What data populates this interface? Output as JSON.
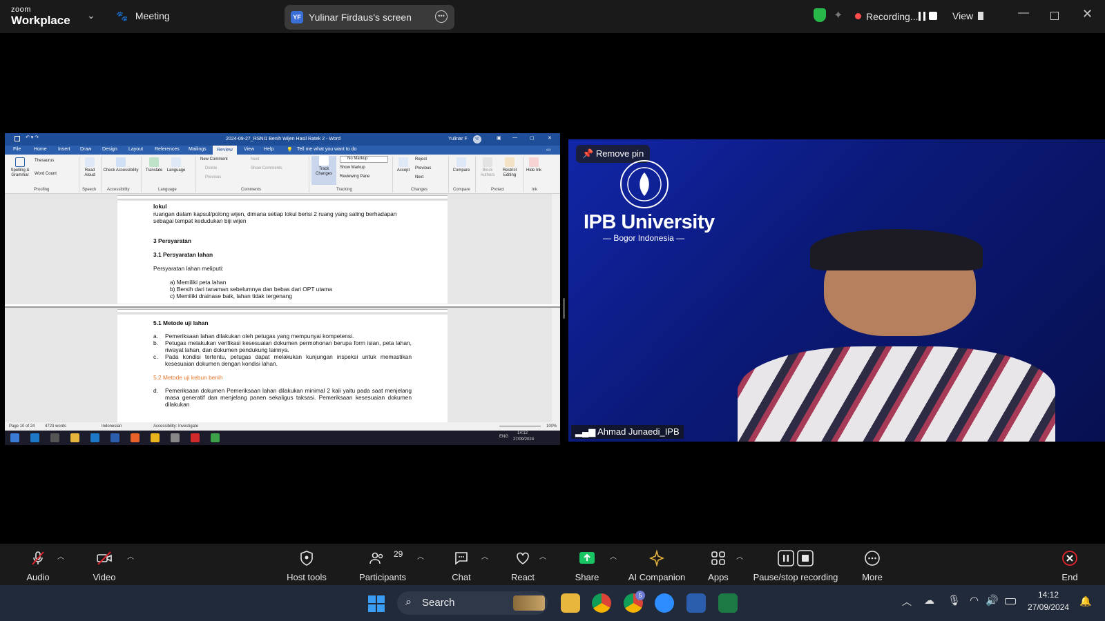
{
  "app": {
    "brand_line1": "zoom",
    "brand_line2": "Workplace",
    "meeting_label": "Meeting"
  },
  "share_indicator": {
    "initials": "YF",
    "label": "Yulinar Firdaus's screen"
  },
  "recording": {
    "label": "Recording..."
  },
  "view_label": "View",
  "word": {
    "title": "2024-09-27_RSNI1 Benih Wijen Hasil Ratek 2  -  Word",
    "user": "Yulinar F",
    "user_initials": "YF",
    "tabs": [
      "File",
      "Home",
      "Insert",
      "Draw",
      "Design",
      "Layout",
      "References",
      "Mailings",
      "Review",
      "View",
      "Help"
    ],
    "tell_me": "Tell me what you want to do",
    "ribbon": {
      "spelling": "Spelling & Grammar",
      "thesaurus": "Thesaurus",
      "word_count": "Word Count",
      "read_aloud": "Read Aloud",
      "check_accessibility": "Check Accessibility",
      "translate": "Translate",
      "language": "Language",
      "new_comment": "New Comment",
      "delete": "Delete",
      "previous": "Previous",
      "next": "Next",
      "show_comments": "Show Comments",
      "track_changes": "Track Changes",
      "no_markup": "No Markup",
      "show_markup": "Show Markup",
      "reviewing_pane": "Reviewing Pane",
      "accept": "Accept",
      "reject": "Reject",
      "prev_change": "Previous",
      "next_change": "Next",
      "compare": "Compare",
      "block_authors": "Block Authors",
      "restrict_editing": "Restrict Editing",
      "hide_ink": "Hide Ink",
      "groups": [
        "Proofing",
        "Speech",
        "Accessibility",
        "Language",
        "Comments",
        "Tracking",
        "Changes",
        "Compare",
        "Protect",
        "Ink"
      ]
    },
    "page1": {
      "term": "lokul",
      "term_def": "ruangan dalam kapsul/polong wijen, dimana setiap lokul berisi 2 ruang yang saling berhadapan sebagai tempat kedudukan biji wijen",
      "h3": "3    Persyaratan",
      "h31": "3.1   Persyaratan lahan",
      "intro": "Persyaratan lahan meliputi:",
      "items": [
        "a)   Memiliki peta lahan",
        "b)   Bersih dari tanaman sebelumnya dan bebas dari OPT utama",
        "c)   Memiliki drainase baik, lahan tidak tergenang"
      ]
    },
    "page2": {
      "h51": "5.1 Metode uji lahan",
      "items": [
        {
          "m": "a.",
          "t": "Pemeriksaan lahan dilakukan oleh petugas yang mempunyai kompetensi."
        },
        {
          "m": "b.",
          "t": "Petugas melakukan verifikasi kesesuaian dokumen permohonan berupa form isian, peta lahan, riwayat lahan, dan dokumen pendukung lainnya."
        },
        {
          "m": "c.",
          "t": "Pada kondisi tertentu, petugas dapat melakukan kunjungan inspeksi untuk memastikan kesesuaian dokumen dengan kondisi lahan."
        }
      ],
      "h52": "5.2 Metode uji kebun benih",
      "item_d": {
        "m": "d.",
        "t": "Pemeriksaan dokumen Pemeriksaan lahan dilakukan minimal 2 kali yaitu pada saat menjelang masa generatif dan menjelang panen sekaligus taksasi. Pemeriksaan kesesuaian dokumen dilakukan"
      }
    },
    "status": {
      "page": "Page 10 of 24",
      "words": "4723 words",
      "language": "Indonesian",
      "accessibility": "Accessibility: Investigate",
      "zoom": "100%"
    },
    "taskbar": {
      "lang": "ENG",
      "time": "14:12",
      "date": "27/09/2024"
    }
  },
  "video": {
    "pin_label": "Remove pin",
    "university": "IPB University",
    "university_sub": "Bogor Indonesia",
    "participant_name": "Ahmad Junaedi_IPB"
  },
  "toolbar": {
    "audio": "Audio",
    "video": "Video",
    "host_tools": "Host tools",
    "participants": "Participants",
    "participants_count": "29",
    "chat": "Chat",
    "react": "React",
    "share": "Share",
    "ai_companion": "AI Companion",
    "apps": "Apps",
    "pause_stop": "Pause/stop recording",
    "more": "More",
    "end": "End"
  },
  "wintaskbar": {
    "search": "Search",
    "chrome_badge": "5",
    "time": "14:12",
    "date": "27/09/2024"
  },
  "colors": {
    "zoom_bar": "#1a1a1a",
    "word_blue": "#1f4e99",
    "share_green": "#19c462",
    "end_red": "#e0242b",
    "recording_red": "#ff4d4d",
    "video_blue": "#1126a8"
  }
}
